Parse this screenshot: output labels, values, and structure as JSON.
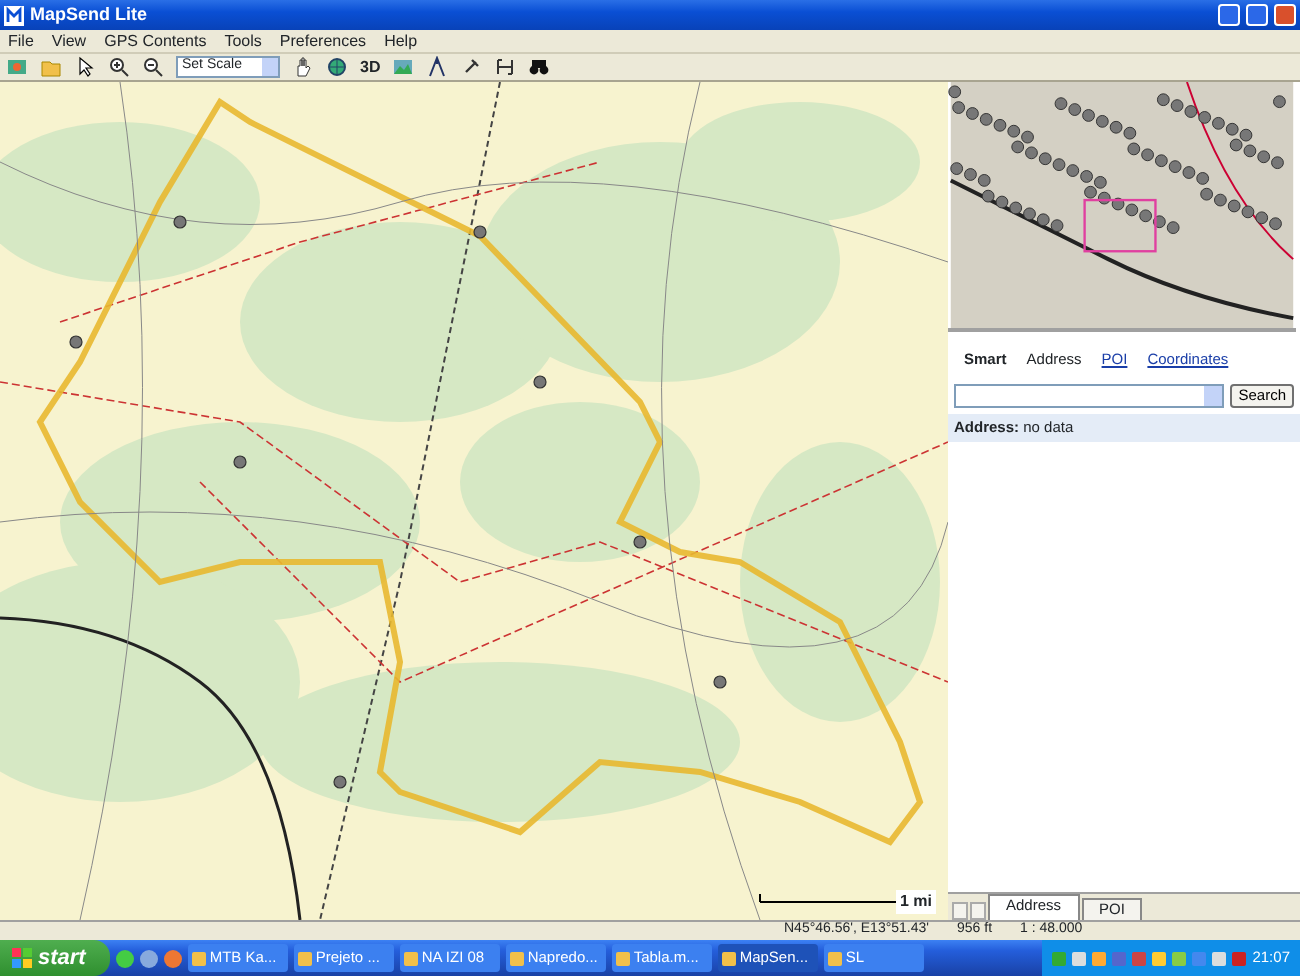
{
  "window": {
    "title": "MapSend Lite"
  },
  "menu": [
    "File",
    "View",
    "GPS Contents",
    "Tools",
    "Preferences",
    "Help"
  ],
  "toolbar": {
    "scale_select": "Set Scale",
    "view_3d": "3D"
  },
  "map": {
    "scale_label": "1 mi"
  },
  "search_panel": {
    "tabs": [
      {
        "label": "Smart",
        "selected": true,
        "kind": "plain"
      },
      {
        "label": "Address",
        "selected": false,
        "kind": "plain"
      },
      {
        "label": "POI",
        "selected": false,
        "kind": "link"
      },
      {
        "label": "Coordinates",
        "selected": false,
        "kind": "link"
      }
    ],
    "search_button": "Search",
    "result_label": "Address:",
    "result_value": "no data"
  },
  "bottom_tabs": [
    {
      "label": "Address",
      "selected": true
    },
    {
      "label": "POI",
      "selected": false
    }
  ],
  "status_bar": {
    "coordinates": "N45°46.56', E13°51.43'",
    "elevation": "956 ft",
    "scale": "1 : 48.000"
  },
  "taskbar": {
    "start": "start",
    "tasks": [
      {
        "label": "MTB Ka...",
        "active": false
      },
      {
        "label": "Prejeto ...",
        "active": false
      },
      {
        "label": "NA IZI 08",
        "active": false
      },
      {
        "label": "Napredo...",
        "active": false
      },
      {
        "label": "Tabla.m...",
        "active": false
      },
      {
        "label": "MapSen...",
        "active": true
      },
      {
        "label": "SL",
        "active": false
      }
    ],
    "clock": "21:07"
  }
}
